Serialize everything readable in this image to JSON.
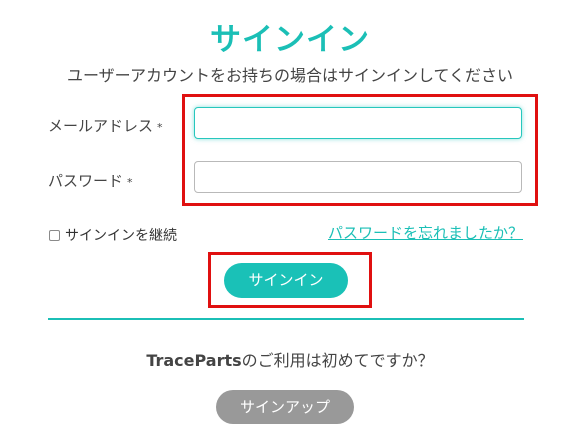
{
  "title": "サインイン",
  "subtitle": "ユーザーアカウントをお持ちの場合はサインインしてください",
  "form": {
    "email": {
      "label": "メールアドレス",
      "required_mark": "*",
      "value": "",
      "placeholder": ""
    },
    "password": {
      "label": "パスワード",
      "required_mark": "*",
      "value": "",
      "placeholder": ""
    },
    "remember_label": "サインインを継続",
    "forgot_link": "パスワードを忘れましたか？",
    "submit_label": "サインイン"
  },
  "signup": {
    "brand": "TraceParts",
    "question": "のご利用は初めてですか？",
    "button_label": "サインアップ"
  },
  "colors": {
    "accent": "#1bbfb6",
    "highlight": "#e01010",
    "secondary_button": "#999999"
  }
}
